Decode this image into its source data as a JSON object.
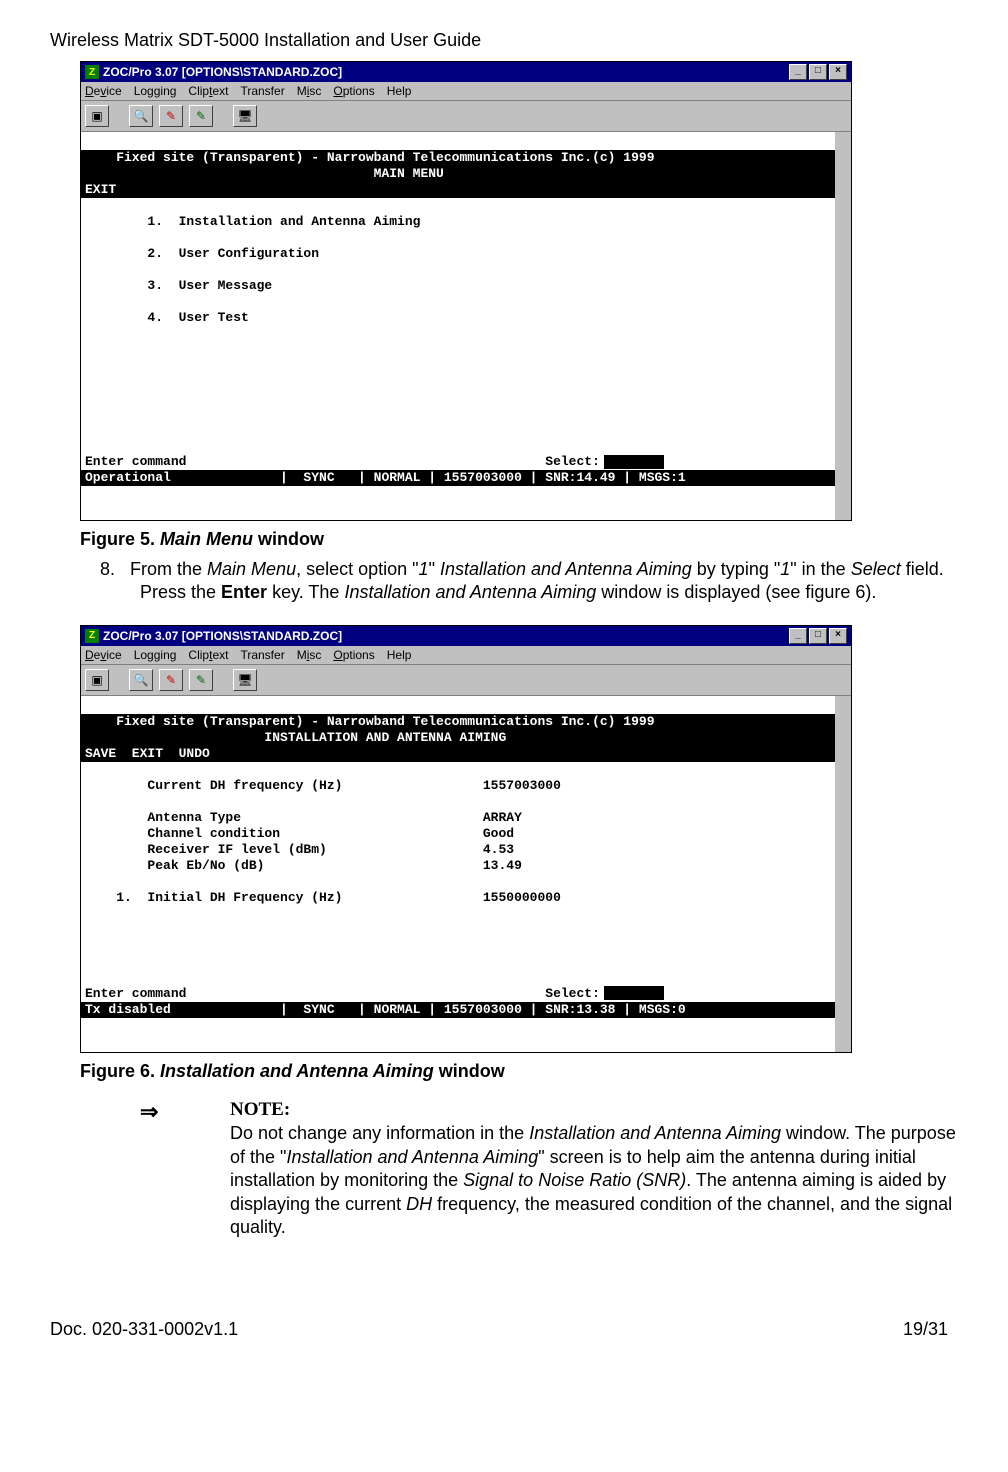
{
  "doc": {
    "header": "Wireless Matrix SDT-5000 Installation and User Guide",
    "footer_left": "Doc. 020-331-0002v1.1",
    "footer_right": "19/31"
  },
  "win_common": {
    "title": "ZOC/Pro 3.07 [OPTIONS\\STANDARD.ZOC]",
    "menu": {
      "device": "Device",
      "logging": "Logging",
      "cliptext": "Cliptext",
      "transfer": "Transfer",
      "misc": "Misc",
      "options": "Options",
      "help": "Help"
    },
    "min": "_",
    "max": "□",
    "close": "×"
  },
  "fig5": {
    "header_line": "    Fixed site (Transparent) - Narrowband Telecommunications Inc.(c) 1999",
    "title_line": "                                     MAIN MENU",
    "exit": "EXIT",
    "item1": "        1.  Installation and Antenna Aiming",
    "item2": "        2.  User Configuration",
    "item3": "        3.  User Message",
    "item4": "        4.  User Test",
    "enter": "Enter command                                              Select:",
    "status": "Operational              |  SYNC   | NORMAL | 1557003000 | SNR:14.49 | MSGS:1",
    "caption_bold": "Figure 5.  ",
    "caption_italic": "Main Menu",
    "caption_tail": " window"
  },
  "step8": {
    "num": "8.",
    "p1a": "From the ",
    "p1b": "Main Menu",
    "p1c": ", select option \"",
    "p1d": "1",
    "p1e": "\" ",
    "p1f": "Installation and Antenna Aiming",
    "p1g": " by typing \"",
    "p1h": "1",
    "p1i": "\" in the ",
    "p1j": "Select",
    "p1k": " field.  Press the ",
    "p1l": "Enter",
    "p1m": " key.  The ",
    "p1n": "Installation and Antenna Aiming",
    "p1o": " window is displayed (see figure 6)."
  },
  "fig6": {
    "header_line": "    Fixed site (Transparent) - Narrowband Telecommunications Inc.(c) 1999",
    "title_line": "                       INSTALLATION AND ANTENNA AIMING",
    "save_exit": "SAVE  EXIT  UNDO",
    "r1": "        Current DH frequency (Hz)                  1557003000",
    "r2": "        Antenna Type                               ARRAY",
    "r3": "        Channel condition                          Good",
    "r4": "        Receiver IF level (dBm)                    4.53",
    "r5": "        Peak Eb/No (dB)                            13.49",
    "r6": "    1.  Initial DH Frequency (Hz)                  1550000000",
    "enter": "Enter command                                              Select:",
    "status": "Tx disabled              |  SYNC   | NORMAL | 1557003000 | SNR:13.38 | MSGS:0",
    "caption_bold": "Figure 6.  ",
    "caption_italic": "Installation and Antenna Aiming",
    "caption_tail": " window"
  },
  "note": {
    "arrow": "⇒",
    "label": "NOTE:",
    "l1a": "Do not change any information in the ",
    "l1b": "Installation and Antenna Aiming",
    "l1c": " window.  The purpose of the \"",
    "l1d": "Installation and Antenna Aiming",
    "l1e": "\" screen is to help aim the antenna during initial installation by monitoring the ",
    "l1f": "Signal to Noise Ratio (SNR)",
    "l1g": ".  The antenna aiming is aided by displaying the current ",
    "l1h": "DH",
    "l1i": " frequency, the measured condition of the channel, and the signal quality."
  }
}
